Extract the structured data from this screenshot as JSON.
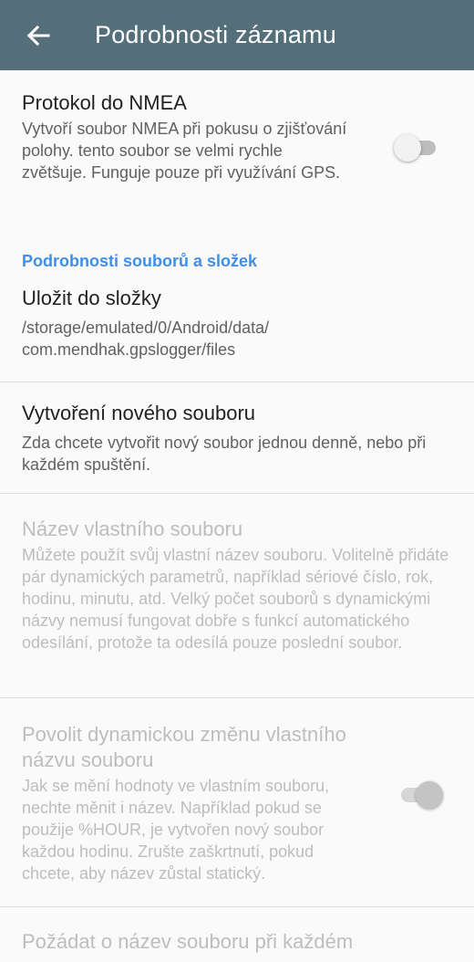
{
  "appbar": {
    "title": "Podrobnosti záznamu",
    "back_icon": "arrow-left-icon"
  },
  "prefs": {
    "nmea": {
      "title": "Protokol do NMEA",
      "summary": "Vytvoří soubor NMEA při pokusu o zjišťování polohy. tento soubor se velmi rychle zvětšuje. Funguje pouze při využívání GPS.",
      "checked": false
    },
    "category_files": "Podrobnosti souborů a složek",
    "save_folder": {
      "title": "Uložit do složky",
      "summary": "/storage/emulated/0/Android/data/\ncom.mendhak.gpslogger/files"
    },
    "new_file": {
      "title": "Vytvoření nového souboru",
      "summary": "Zda chcete vytvořit nový soubor jednou denně, nebo při každém spuštění."
    },
    "custom_name": {
      "title": "Název vlastního souboru",
      "summary": "Můžete použít svůj vlastní název souboru. Volitelně přidáte pár dynamických parametrů, například sériové číslo, rok, hodinu, minutu, atd. Velký počet souborů s dynamickými názvy nemusí fungovat dobře s funkcí automatického odesílání, protože ta odesílá pouze poslední soubor.",
      "enabled": false
    },
    "dynamic_name": {
      "title": "Povolit dynamickou změnu vlastního názvu souboru",
      "summary": "Jak se mění hodnoty ve vlastním souboru, nechte měnit i název. Například pokud se použije %HOUR, je vytvořen nový soubor každou hodinu. Zrušte zaškrtnutí, pokud chcete, aby název zůstal statický.",
      "enabled": false,
      "checked": true
    },
    "ask_name": {
      "title": "Požádat o název souboru při každém",
      "enabled": false
    }
  }
}
